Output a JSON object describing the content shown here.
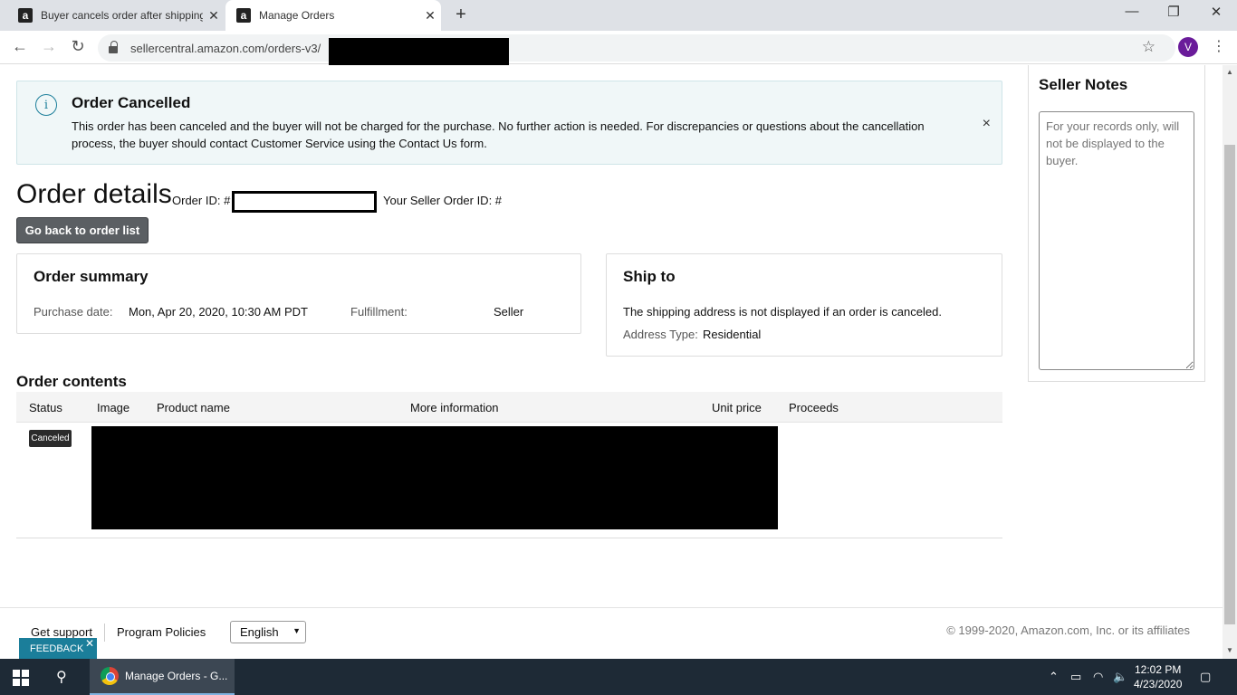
{
  "browser": {
    "tabs": [
      {
        "title": "Buyer cancels order after shipping",
        "favicon": "a"
      },
      {
        "title": "Manage Orders",
        "favicon": "a"
      }
    ],
    "url": "sellercentral.amazon.com/orders-v3/",
    "profile_initial": "V"
  },
  "alert": {
    "title": "Order Cancelled",
    "message": "This order has been canceled and the buyer will not be charged for the purchase. No further action is needed. For discrepancies or questions about the cancellation process, the buyer should contact Customer Service using the Contact Us form.",
    "close": "×"
  },
  "order": {
    "heading": "Order details",
    "order_id_label": "Order ID: #",
    "seller_order_id_label": "Your Seller Order ID: #",
    "back_button": "Go back to order list"
  },
  "summary": {
    "title": "Order summary",
    "purchase_date_label": "Purchase date:",
    "purchase_date": "Mon, Apr 20, 2020, 10:30 AM PDT",
    "fulfillment_label": "Fulfillment:",
    "fulfillment": "Seller"
  },
  "ship_to": {
    "title": "Ship to",
    "message": "The shipping address is not displayed if an order is canceled.",
    "address_type_label": "Address Type:",
    "address_type": "Residential"
  },
  "contents": {
    "title": "Order contents",
    "columns": [
      "Status",
      "Image",
      "Product name",
      "More information",
      "Unit price",
      "Proceeds"
    ],
    "rows": [
      {
        "status": "Canceled"
      }
    ]
  },
  "seller_notes": {
    "title": "Seller Notes",
    "placeholder": "For your records only, will not be displayed to the buyer."
  },
  "footer": {
    "get_support": "Get support",
    "program_policies": "Program Policies",
    "language": "English",
    "copyright": "© 1999-2020, Amazon.com, Inc. or its affiliates",
    "feedback": "FEEDBACK"
  },
  "taskbar": {
    "app_title": "Manage Orders - G...",
    "time": "12:02 PM",
    "date": "4/23/2020"
  },
  "colors": {
    "alert_bg": "#f0f7f8",
    "info_accent": "#1b7e9a",
    "button_dark": "#5b5f63",
    "taskbar": "#1e2a36"
  }
}
